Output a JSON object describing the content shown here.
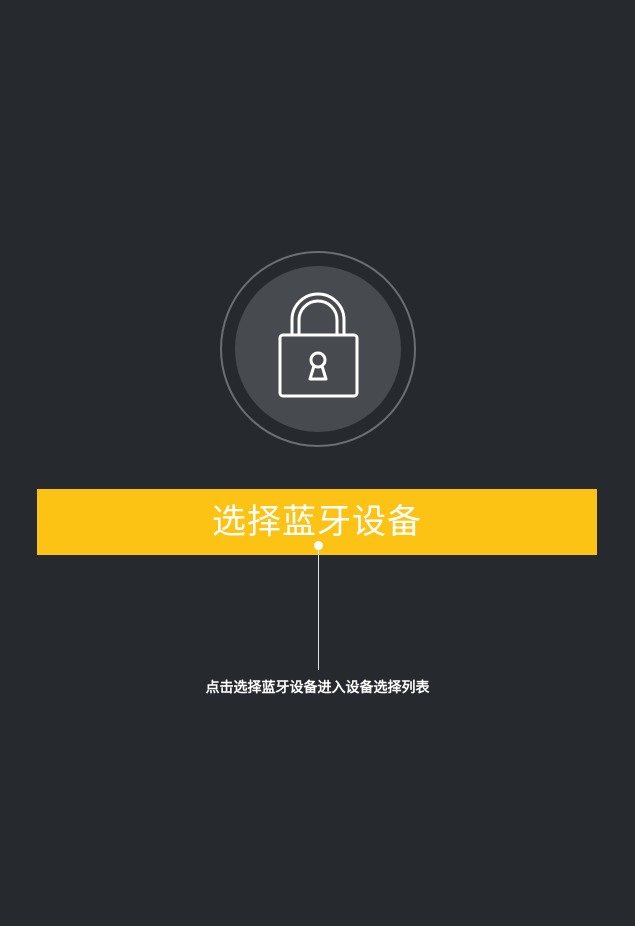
{
  "lock": {
    "icon": "padlock-icon"
  },
  "action": {
    "select_label": "选择蓝牙设备"
  },
  "hint": {
    "text": "点击选择蓝牙设备进入设备选择列表"
  },
  "colors": {
    "background": "#26292e",
    "accent": "#fdc314",
    "circle_fill": "#474b50",
    "circle_ring": "#6a6f74",
    "foreground": "#ffffff"
  }
}
